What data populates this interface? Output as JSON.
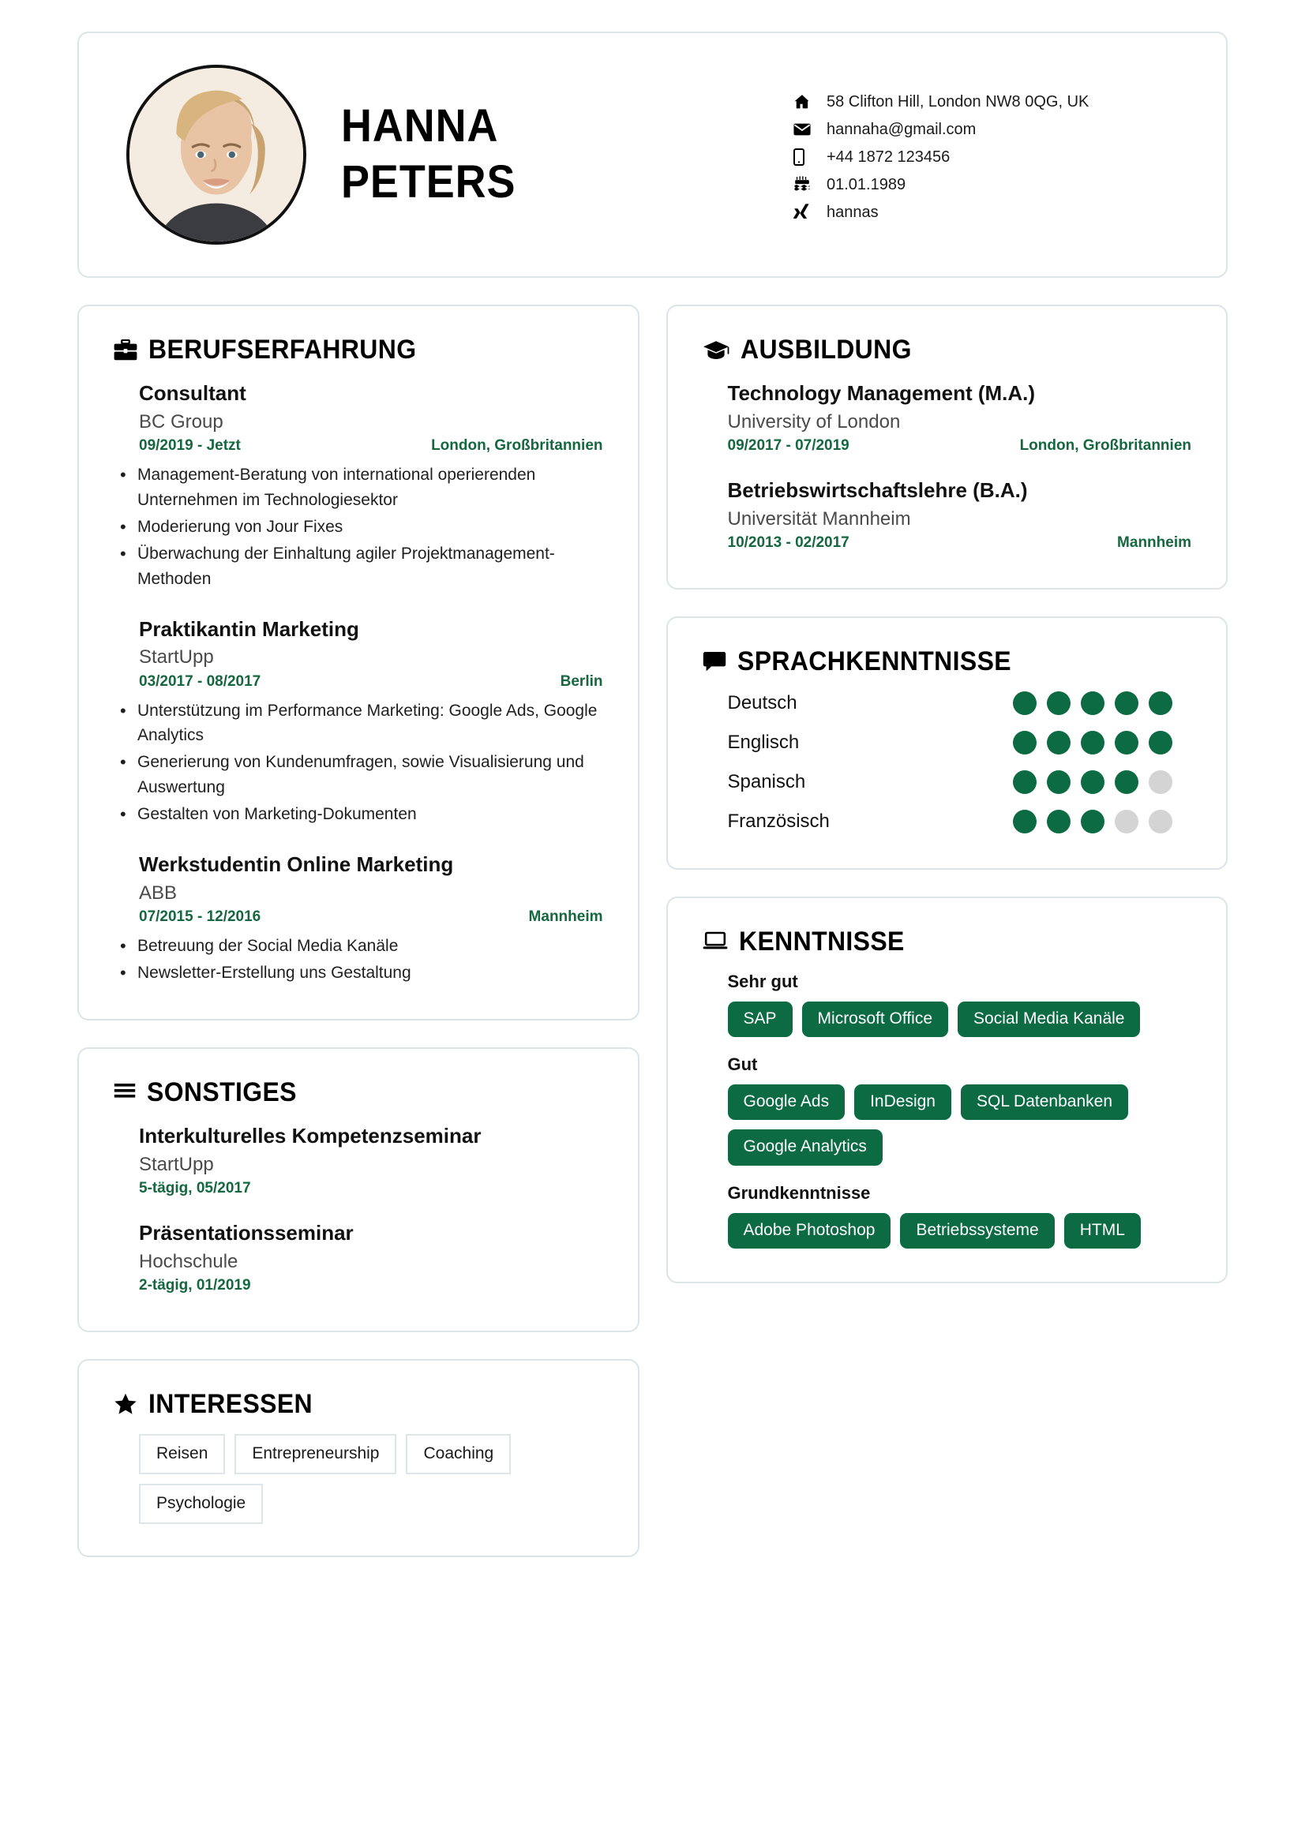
{
  "colors": {
    "accent_green": "#0c6b42",
    "card_border": "#dde4e8",
    "dot_off": "#d4d4d4",
    "text_muted": "#4a4a4a"
  },
  "header": {
    "first_name": "HANNA",
    "last_name": "PETERS",
    "photo_alt": "profile-photo",
    "contact": [
      {
        "icon": "home-icon",
        "text": "58 Clifton Hill, London NW8 0QG, UK"
      },
      {
        "icon": "envelope-icon",
        "text": "hannaha@gmail.com"
      },
      {
        "icon": "phone-icon",
        "text": "+44 1872 123456"
      },
      {
        "icon": "cake-icon",
        "text": "01.01.1989"
      },
      {
        "icon": "xing-icon",
        "text": "hannas"
      }
    ]
  },
  "experience": {
    "title": "BERUFSERFAHRUNG",
    "icon": "briefcase-icon",
    "entries": [
      {
        "role": "Consultant",
        "company": "BC Group",
        "dates": "09/2019 - Jetzt",
        "location": "London, Großbritannien",
        "bullets": [
          "Management-Beratung von international operierenden Unternehmen im Technologiesektor",
          "Moderierung von Jour Fixes",
          "Überwachung der Einhaltung agiler Projektmanagement-Methoden"
        ]
      },
      {
        "role": "Praktikantin Marketing",
        "company": "StartUpp",
        "dates": "03/2017 - 08/2017",
        "location": "Berlin",
        "bullets": [
          "Unterstützung im Performance Marketing: Google Ads, Google Analytics",
          "Generierung von Kundenumfragen, sowie Visualisierung und Auswertung",
          "Gestalten von Marketing-Dokumenten"
        ]
      },
      {
        "role": "Werkstudentin Online Marketing",
        "company": "ABB",
        "dates": "07/2015 - 12/2016",
        "location": "Mannheim",
        "bullets": [
          "Betreuung der Social Media Kanäle",
          "Newsletter-Erstellung uns Gestaltung"
        ]
      }
    ]
  },
  "other": {
    "title": "SONSTIGES",
    "icon": "list-icon",
    "entries": [
      {
        "name": "Interkulturelles Kompetenzseminar",
        "org": "StartUpp",
        "dates": "5-tägig, 05/2017",
        "location": ""
      },
      {
        "name": "Präsentationsseminar",
        "org": "Hochschule",
        "dates": "2-tägig, 01/2019",
        "location": ""
      }
    ]
  },
  "interests": {
    "title": "INTERESSEN",
    "icon": "star-icon",
    "tags": [
      "Reisen",
      "Entrepreneurship",
      "Coaching",
      "Psychologie"
    ]
  },
  "education": {
    "title": "AUSBILDUNG",
    "icon": "graduation-cap-icon",
    "entries": [
      {
        "degree": "Technology Management (M.A.)",
        "school": "University of London",
        "dates": "09/2017 - 07/2019",
        "location": "London, Großbritannien"
      },
      {
        "degree": "Betriebswirtschaftslehre (B.A.)",
        "school": "Universität Mannheim",
        "dates": "10/2013 - 02/2017",
        "location": "Mannheim"
      }
    ]
  },
  "languages": {
    "title": "SPRACHKENNTNISSE",
    "icon": "speech-bubble-icon",
    "max_level": 5,
    "items": [
      {
        "name": "Deutsch",
        "level": 5
      },
      {
        "name": "Englisch",
        "level": 5
      },
      {
        "name": "Spanisch",
        "level": 4
      },
      {
        "name": "Französisch",
        "level": 3
      }
    ]
  },
  "skills": {
    "title": "KENNTNISSE",
    "icon": "laptop-icon",
    "groups": [
      {
        "level": "Sehr gut",
        "items": [
          "SAP",
          "Microsoft Office",
          "Social Media Kanäle"
        ]
      },
      {
        "level": "Gut",
        "items": [
          "Google Ads",
          "InDesign",
          "SQL Datenbanken",
          "Google Analytics"
        ]
      },
      {
        "level": "Grundkenntnisse",
        "items": [
          "Adobe Photoshop",
          "Betriebssysteme",
          "HTML"
        ]
      }
    ]
  }
}
